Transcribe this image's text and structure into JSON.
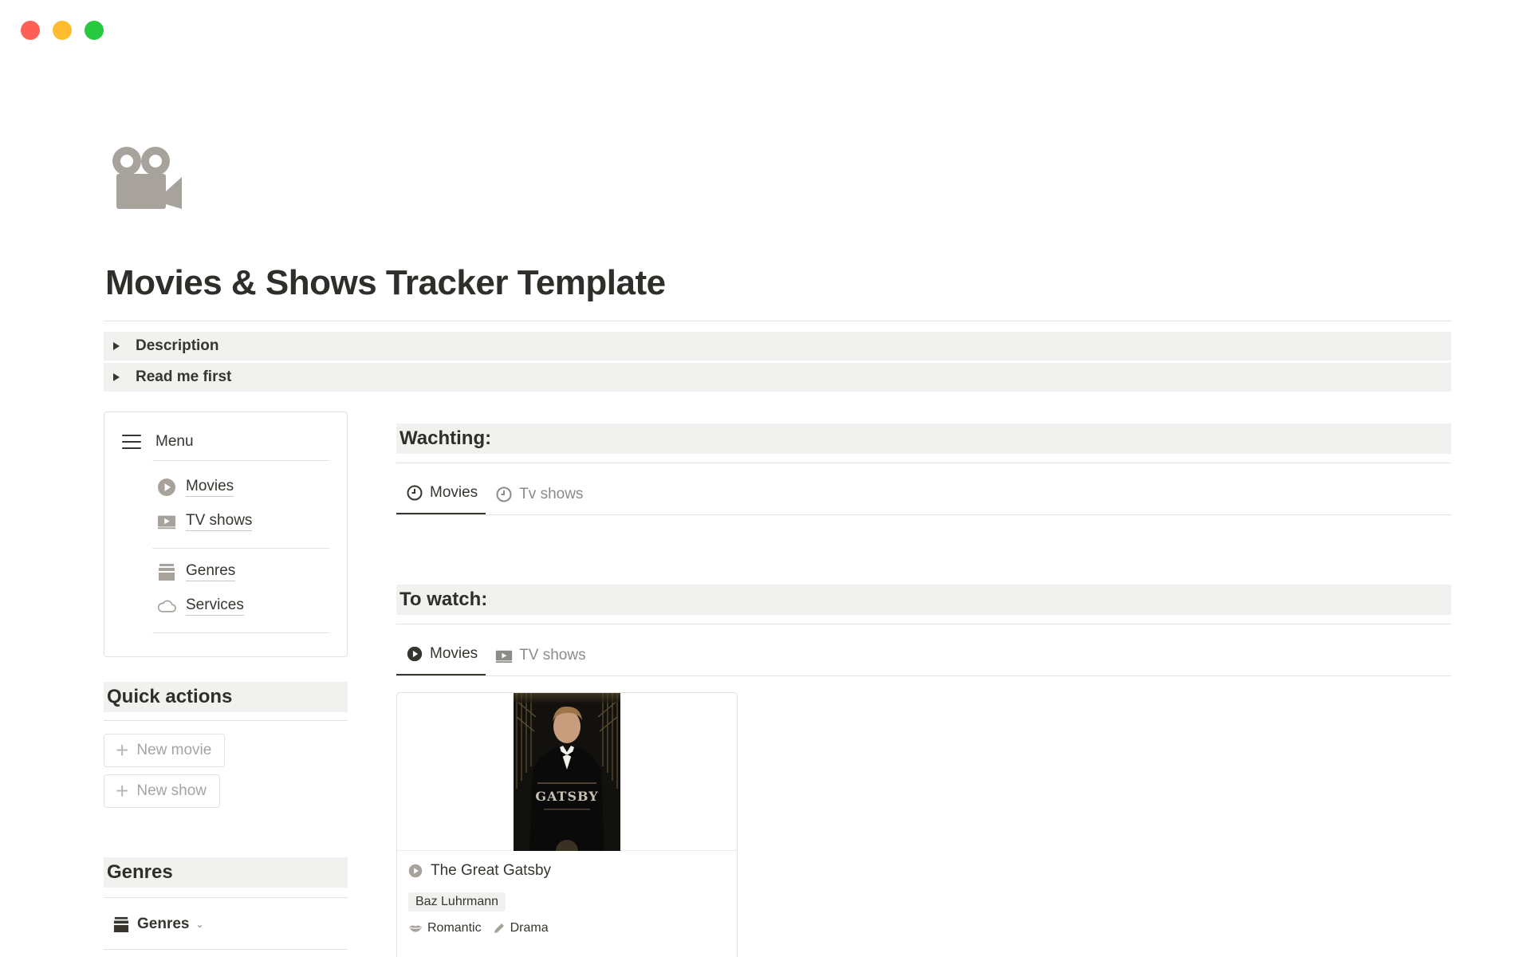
{
  "window": {
    "controls": [
      "close",
      "minimize",
      "zoom"
    ]
  },
  "page": {
    "icon": "movie-camera-icon",
    "title": "Movies & Shows Tracker Template"
  },
  "toggles": [
    {
      "label": "Description"
    },
    {
      "label": "Read me first"
    }
  ],
  "menu": {
    "heading": "Menu",
    "items": [
      {
        "label": "Movies",
        "icon": "play-circle-icon"
      },
      {
        "label": "TV shows",
        "icon": "tv-play-icon"
      },
      {
        "label": "Genres",
        "icon": "archive-box-icon"
      },
      {
        "label": "Services",
        "icon": "cloud-icon"
      }
    ]
  },
  "quick_actions": {
    "heading": "Quick actions",
    "buttons": [
      {
        "label": "New movie"
      },
      {
        "label": "New show"
      }
    ]
  },
  "genres_section": {
    "heading": "Genres",
    "dropdown_label": "Genres"
  },
  "watching": {
    "heading": "Wachting:",
    "tabs": [
      {
        "label": "Movies",
        "icon": "clock-icon",
        "active": true
      },
      {
        "label": "Tv shows",
        "icon": "clock-icon",
        "active": false
      }
    ]
  },
  "to_watch": {
    "heading": "To watch:",
    "tabs": [
      {
        "label": "Movies",
        "icon": "play-circle-icon",
        "active": true
      },
      {
        "label": "TV shows",
        "icon": "tv-play-icon",
        "active": false
      }
    ],
    "cards": [
      {
        "poster_text": "GATSBY",
        "title": "The Great Gatsby",
        "director": "Baz Luhrmann",
        "tags": [
          {
            "label": "Romantic",
            "icon": "lips-icon"
          },
          {
            "label": "Drama",
            "icon": "pen-icon"
          }
        ]
      }
    ]
  },
  "colors": {
    "text": "#37352f",
    "muted": "#8c8b87",
    "block_bg": "#f1f1ef",
    "border": "#e3e2df",
    "icon_gray": "#a7a29b"
  }
}
